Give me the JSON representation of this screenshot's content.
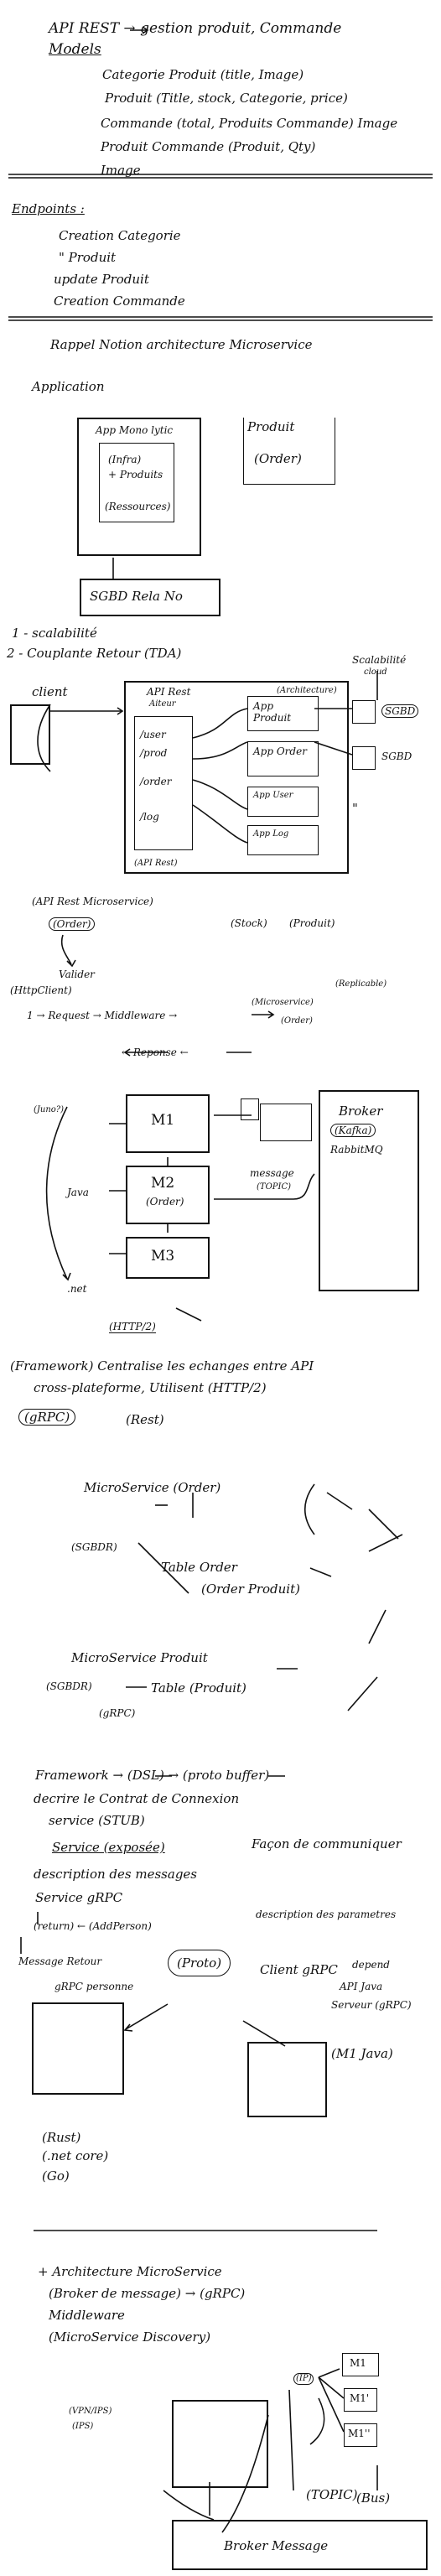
{
  "header": {
    "line1": "API REST → gestion produit, Commande",
    "models_label": "Models",
    "models": [
      "Categorie Produit (title, Image)",
      "Produit (Title, stock, Categorie, price)",
      "Commande (total, Produits Commande) Image",
      "Produit Commande (Produit, Qty)",
      "Image"
    ]
  },
  "endpoints": {
    "label": "Endpoints :",
    "items": [
      "Creation Categorie",
      "\"   Produit",
      "update Produit",
      "Creation Commande"
    ]
  },
  "rappel": {
    "title": "Rappel Notion architecture Microservice",
    "application": "Application",
    "mono_app": [
      "App Mono lytic",
      "(Infra)",
      "+ Produits",
      "(Ressources)"
    ],
    "produit_box": [
      "Produit",
      "(Order)"
    ],
    "sgbd": "SGBD Rela No",
    "points": [
      "1 - scalabilité",
      "2 - Couplante Retour (TDA)"
    ]
  },
  "arch": {
    "client": "client",
    "api_rest": [
      "API Rest",
      "Aiteur"
    ],
    "routes": [
      "/user",
      "/prod",
      "/order",
      "/log"
    ],
    "api_rest_label": "(API Rest)",
    "architecture": "(Architecture)",
    "services": [
      "App Produit",
      "App Order",
      "App User",
      "App Log"
    ],
    "scal_label": "Scalabilité",
    "scal_sub": "cloud",
    "sgbd": [
      "SGBD",
      "SGBD"
    ],
    "quote": "\"",
    "ms_label": "(API Rest Microservice)",
    "order": "(Order)",
    "stock": "(Stock)",
    "produit": "(Produit)",
    "valider": "Valider",
    "http_client": "(HttpClient)",
    "request_flow": "1 → Request → Middleware →",
    "microservice": "(Microservice)",
    "replicable": "(Replicable)",
    "reponse": "← Reponse ←",
    "order2": "(Order)"
  },
  "micro": {
    "m1": "M1",
    "m2": "M2",
    "m2_sub": "(Order)",
    "m3": "M3",
    "java": "Java",
    "juno": "(Juno?)",
    "net": ".net",
    "message": "message",
    "topic": "(TOPIC)",
    "broker": "Broker",
    "kafka": "(Kafka)",
    "rabbit": "RabbitMQ",
    "http2": "(HTTP/2)"
  },
  "grpc": {
    "framework": "(Framework) Centralise les echanges entre API",
    "cross": "cross-plateforme, Utilisent (HTTP/2)",
    "grpc": "(gRPC)",
    "rest": "(Rest)"
  },
  "orders": {
    "ms_order": "MicroService (Order)",
    "sgbd": "(SGBDR)",
    "table_order": "Table Order",
    "order_produit": "(Order Produit)",
    "ms_produit": "MicroService Produit",
    "sgbdr2": "(SGBDR)",
    "table_produit": "Table (Produit)",
    "grpc": "(gRPC)"
  },
  "proto": {
    "framework_line": "Framework → (DSL) → (proto buffer)",
    "decrire": "decrire le Contrat de Connexion",
    "service_stub": "service (STUB)",
    "service_exposee": "Service (exposée)",
    "facon": "Façon de communiquer",
    "desc_messages": "description des messages",
    "service_grpc": "Service gRPC",
    "return_line": "(return) ← (AddPerson)",
    "desc_params": "description des parametres",
    "message_retour": "Message Retour",
    "proto": "(Proto)",
    "client_grpc": "Client gRPC",
    "grpc_personne": "gRPC personne",
    "api_java": [
      "API Java",
      "Serveur (gRPC)"
    ],
    "depend": "depend",
    "m1_java": "(M1 Java)",
    "langs": [
      "(Rust)",
      "(.net core)",
      "(Go)"
    ]
  },
  "arch_ms": {
    "title": "+ Architecture MicroService",
    "items": [
      "(Broker de message) → (gRPC)",
      "Middleware",
      "(MicroService Discovery)"
    ],
    "m1": "M1",
    "m1p": "M1'",
    "m1pp": "M1''",
    "ip": "(IP)",
    "vpn_ips": "(VPN/IPS)",
    "ips": "(IPS)",
    "topic": "(TOPIC)",
    "bus": "(Bus)",
    "broker_message": "Broker Message"
  }
}
